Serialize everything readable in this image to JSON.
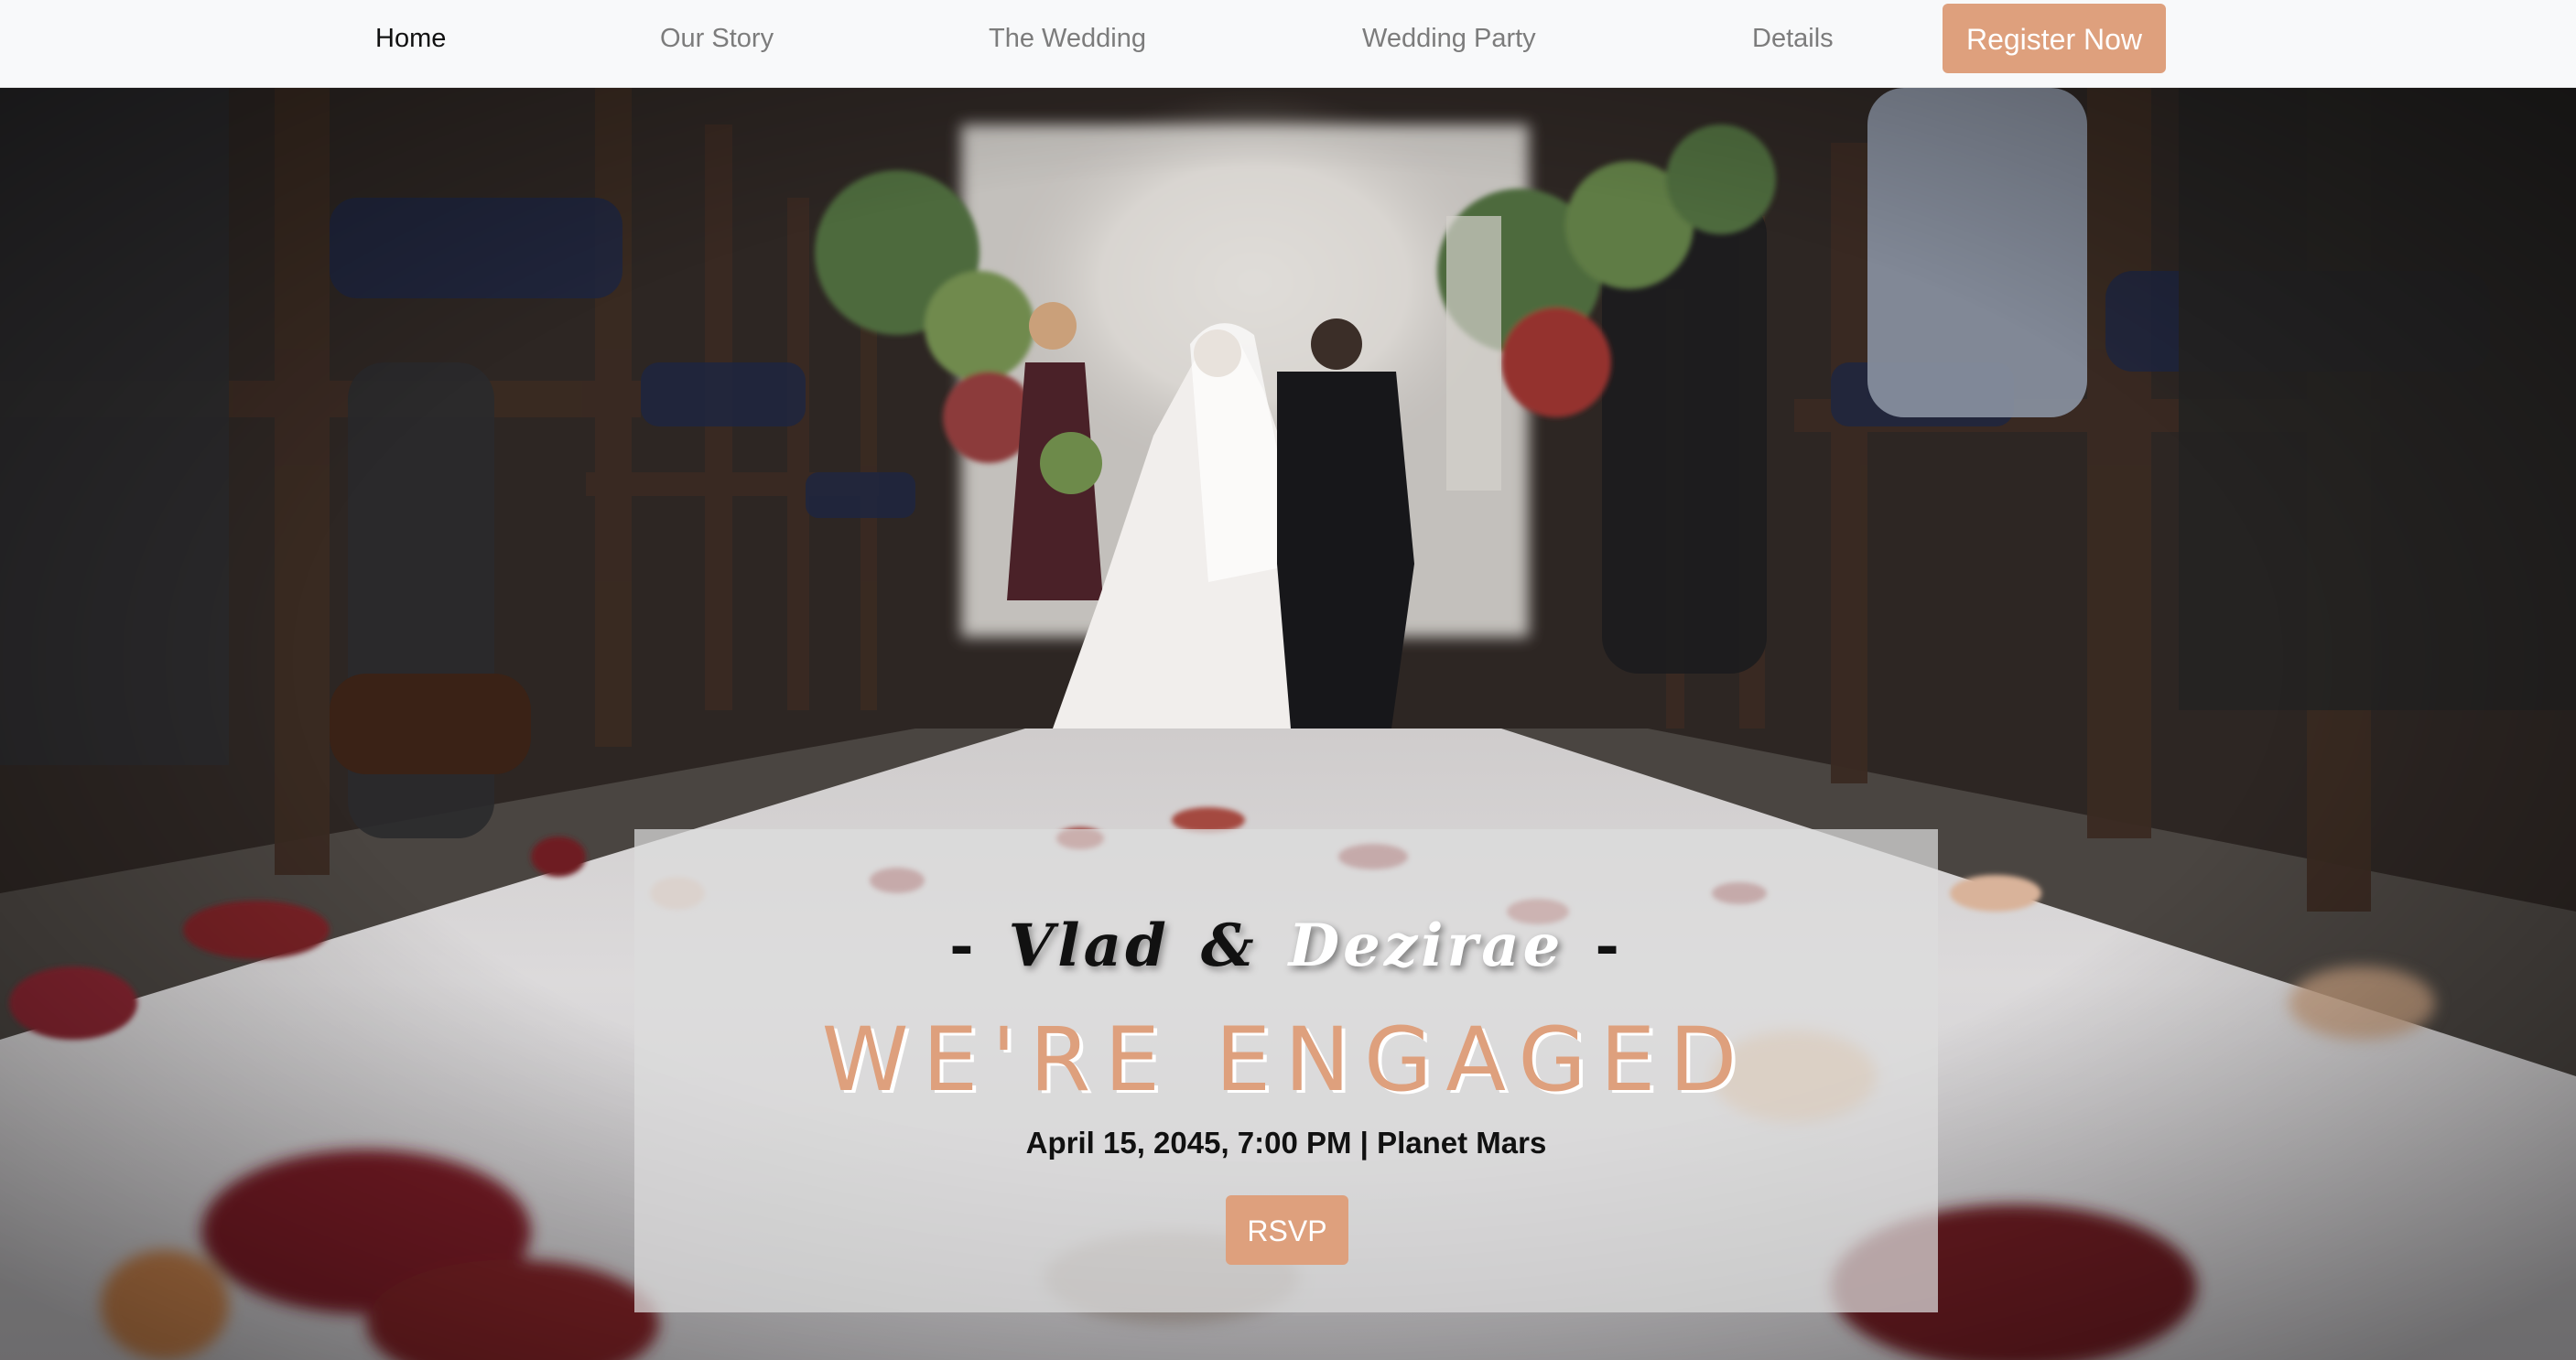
{
  "navbar": {
    "links": [
      {
        "label": "Home",
        "active": true
      },
      {
        "label": "Our Story",
        "active": false
      },
      {
        "label": "The Wedding",
        "active": false
      },
      {
        "label": "Wedding Party",
        "active": false
      },
      {
        "label": "Details",
        "active": false
      }
    ],
    "register_label": "Register Now"
  },
  "hero": {
    "couple": {
      "dash_left": "-",
      "name1": "Vlad",
      "amp": "&",
      "name2": "Dezirae",
      "dash_right": "-"
    },
    "headline": "WE'RE ENGAGED",
    "event": "April 15, 2045, 7:00 PM | Planet Mars",
    "rsvp_label": "RSVP"
  },
  "colors": {
    "accent": "#dea07d",
    "navbar_bg": "#f8f9fa",
    "card_bg": "rgba(220,220,220,0.72)"
  }
}
